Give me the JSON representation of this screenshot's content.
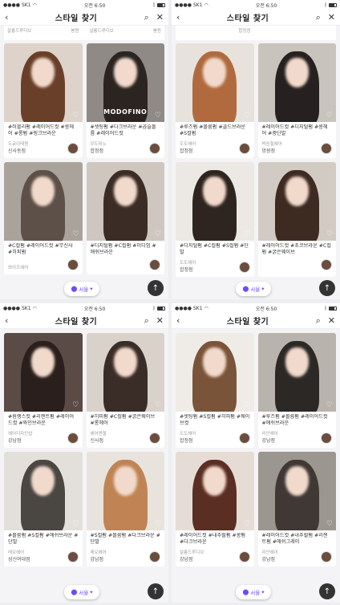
{
  "status": {
    "carrier": "SK1",
    "time": "오전 6:50"
  },
  "nav": {
    "title": "스타일 찾기"
  },
  "location": {
    "label": "서울"
  },
  "screens": [
    {
      "top_strip": [
        {
          "salon": "살롱드루디브",
          "loc": "봉원"
        },
        {
          "salon": "살롱드루디브",
          "loc": "봉원"
        }
      ],
      "cards": [
        {
          "tags": "#러블리펌 #레이어드컷 #롱헤어 #롱펌 #핑크브라운",
          "salon": "도쿄이태원",
          "loc": "신사동점",
          "watermark": "",
          "hair": "#6a3f2a",
          "bg": "#ddd3ca"
        },
        {
          "tags": "#셋팅펌 #다크브라운 #곱슬볼륨 #레이어드컷",
          "salon": "모도피노",
          "loc": "합정점",
          "watermark": "MODOFINO",
          "hair": "#2b2420",
          "bg": "#8f8a86"
        },
        {
          "tags": "#C컬펌 #레이어드컷 #무신사 #히피펌",
          "salon": "와이즈헤어",
          "loc": "",
          "watermark": "",
          "hair": "#5c5048",
          "bg": "#a9a39c"
        },
        {
          "tags": "#디지털펌 #C컬펌 #미디엄 #애쉬브라운",
          "salon": "",
          "loc": "",
          "watermark": "",
          "hair": "#3b2c25",
          "bg": "#cfc7bf"
        }
      ]
    },
    {
      "top_strip": [
        {
          "salon": "",
          "loc": "합정점"
        },
        {
          "salon": "",
          "loc": ""
        }
      ],
      "cards": [
        {
          "tags": "#루즈펌 #볼륨펌 #골드브라운 #S컬펌",
          "salon": "도도헤어",
          "loc": "합정점",
          "watermark": "",
          "hair": "#b06a3e",
          "bg": "#e7e2dc"
        },
        {
          "tags": "#레이어드컷 #디지털펌 #롱헤어 #중단발",
          "salon": "박승철헤어",
          "loc": "망원점",
          "watermark": "",
          "hair": "#262020",
          "bg": "#c9c3bd"
        },
        {
          "tags": "#디지털펌 #C컬펌 #S컬펌 #단발",
          "salon": "도도헤어",
          "loc": "합정점",
          "watermark": "",
          "hair": "#2f2520",
          "bg": "#ece9e4"
        },
        {
          "tags": "#레이어드컷 #초코브라운 #C컬펌 #굵은웨이브",
          "salon": "",
          "loc": "",
          "watermark": "",
          "hair": "#3d2b22",
          "bg": "#d2cbc4"
        }
      ]
    },
    {
      "top_strip": [],
      "cards": [
        {
          "tags": "#원랭스컷 #리젠트펌 #레이어드컷 #와인브라운",
          "salon": "헤어디자인샵",
          "loc": "강남점",
          "watermark": "",
          "hair": "#2a1f1c",
          "bg": "#5a4b47"
        },
        {
          "tags": "#히피펌 #C컬펌 #굵은웨이브 #롱헤어",
          "salon": "헤어엔젤",
          "loc": "신사점",
          "watermark": "",
          "hair": "#3a2d27",
          "bg": "#d8d2cb"
        },
        {
          "tags": "#볼륨펌 #S컬펌 #애쉬브라운 #단발",
          "salon": "레오헤어",
          "loc": "성신여대점",
          "watermark": "",
          "hair": "#4a4642",
          "bg": "#e3e0dc"
        },
        {
          "tags": "#S컬펌 #볼륨펌 #다크브라운 #단발",
          "salon": "레오헤어",
          "loc": "강남점",
          "watermark": "",
          "hair": "#c08454",
          "bg": "#e9e3dd"
        }
      ]
    },
    {
      "top_strip": [],
      "cards": [
        {
          "tags": "#셋팅펌 #S컬펌 #히피펌 #웨이브컷",
          "salon": "도도헤어",
          "loc": "합정점",
          "watermark": "",
          "hair": "#7a5438",
          "bg": "#efece8"
        },
        {
          "tags": "#루즈펌 #볼륨펌 #레이어드컷 #애쉬브라운",
          "salon": "리안헤어",
          "loc": "강남점",
          "watermark": "",
          "hair": "#2c2826",
          "bg": "#b9b3ad"
        },
        {
          "tags": "#레이어드컷 #내추럴펌 #롱펌 #다크브라운",
          "salon": "살롱드루디브",
          "loc": "강남점",
          "watermark": "",
          "hair": "#5a2e22",
          "bg": "#e6dcd6"
        },
        {
          "tags": "#레이어드컷 #내추럴펌 #리젠트펌 #애쉬그레이",
          "salon": "리안헤어",
          "loc": "강남점",
          "watermark": "",
          "hair": "#403834",
          "bg": "#9c9691"
        }
      ]
    }
  ]
}
